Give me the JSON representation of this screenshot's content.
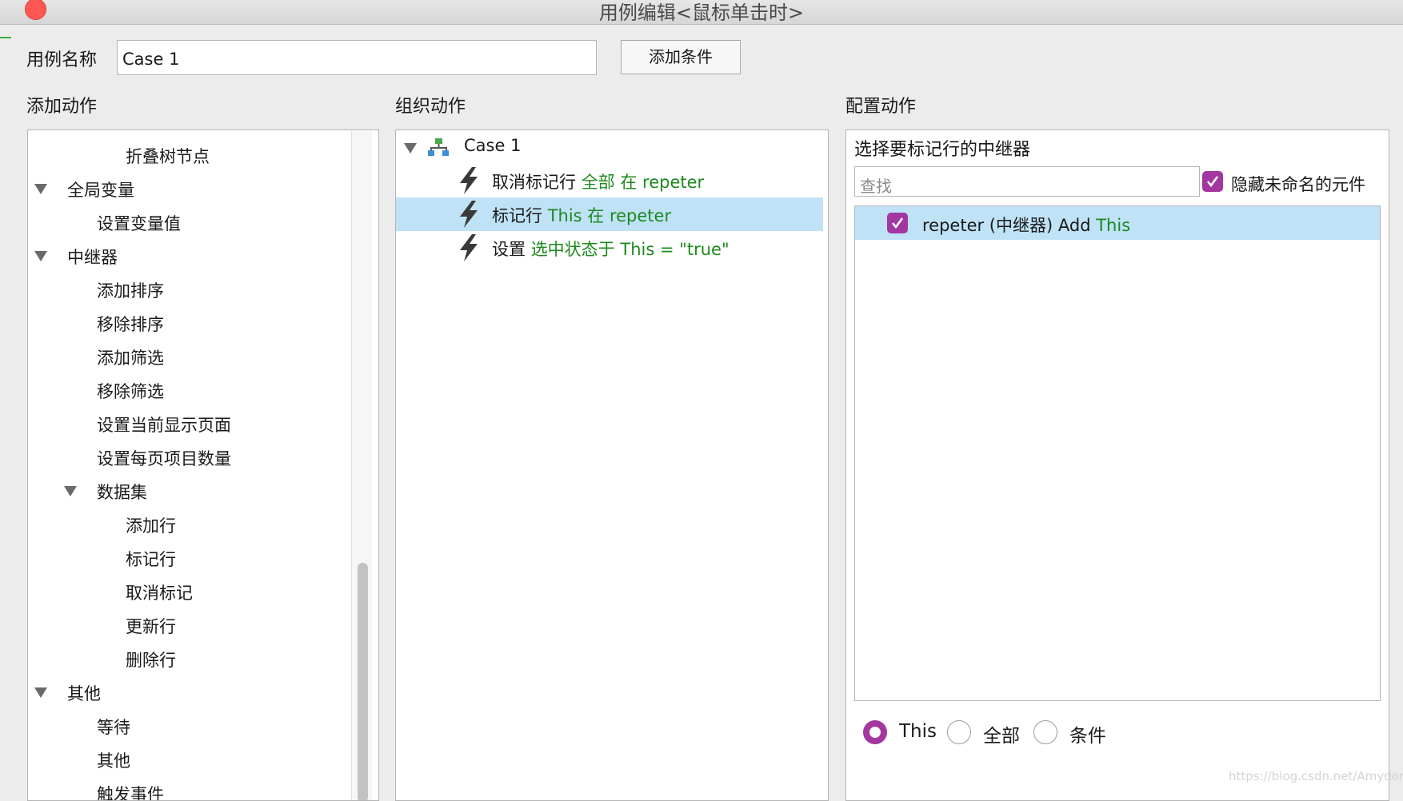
{
  "window": {
    "title": "用例编辑<鼠标单击时>"
  },
  "case_name": {
    "label": "用例名称",
    "value": "Case 1"
  },
  "add_condition_button": "添加条件",
  "sections": {
    "add_actions": "添加动作",
    "organize_actions": "组织动作",
    "configure_actions": "配置动作"
  },
  "add_actions_tree": {
    "folding_node": "折叠树节点",
    "global_vars": {
      "label": "全局变量",
      "items": [
        "设置变量值"
      ]
    },
    "repeater": {
      "label": "中继器",
      "items": [
        "添加排序",
        "移除排序",
        "添加筛选",
        "移除筛选",
        "设置当前显示页面",
        "设置每页项目数量"
      ],
      "dataset": {
        "label": "数据集",
        "items": [
          "添加行",
          "标记行",
          "取消标记",
          "更新行",
          "删除行"
        ]
      }
    },
    "other": {
      "label": "其他",
      "items": [
        "等待",
        "其他",
        "触发事件"
      ]
    }
  },
  "organize": {
    "case_label": "Case 1",
    "actions": [
      {
        "verb": "取消标记行",
        "detail": "全部 在 repeter",
        "selected": false
      },
      {
        "verb": "标记行",
        "detail": "This 在 repeter",
        "selected": true
      },
      {
        "verb": "设置",
        "detail": "选中状态于 This = \"true\"",
        "selected": false
      }
    ]
  },
  "configure": {
    "heading": "选择要标记行的中继器",
    "search_placeholder": "查找",
    "hide_unnamed": {
      "label": "隐藏未命名的元件",
      "checked": true
    },
    "repeater_item": {
      "text": "repeter (中继器) Add",
      "value": "This",
      "checked": true
    },
    "radio": {
      "options": [
        "This",
        "全部",
        "条件"
      ],
      "selected": "This"
    }
  },
  "watermark": "https://blog.csdn.net/Amydom",
  "colors": {
    "accent": "#a2379f",
    "selection": "#bfe2f7",
    "green_text": "#1c8a1c",
    "close": "#fc5753"
  },
  "icons": {
    "close": "close-icon",
    "case": "case-tree-icon",
    "action": "lightning-icon",
    "expand": "triangle-down-icon",
    "check": "checkmark-icon"
  }
}
